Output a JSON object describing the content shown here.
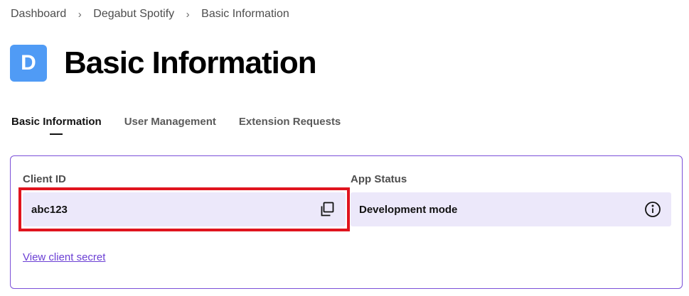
{
  "breadcrumb": {
    "items": [
      "Dashboard",
      "Degabut Spotify",
      "Basic Information"
    ],
    "separator": "›"
  },
  "header": {
    "avatar_letter": "D",
    "avatar_color": "#509bf5",
    "title": "Basic Information"
  },
  "tabs": [
    {
      "label": "Basic Information",
      "active": true
    },
    {
      "label": "User Management",
      "active": false
    },
    {
      "label": "Extension Requests",
      "active": false
    }
  ],
  "card": {
    "client_id": {
      "label": "Client ID",
      "value": "abc123",
      "action_icon": "copy-icon",
      "highlight_color": "#e0141e"
    },
    "app_status": {
      "label": "App Status",
      "value": "Development mode",
      "action_icon": "info-icon"
    },
    "secret_link": "View client secret",
    "border_color": "#7b4fd8",
    "field_bg": "#ece8fa",
    "link_color": "#6b3fd4"
  }
}
